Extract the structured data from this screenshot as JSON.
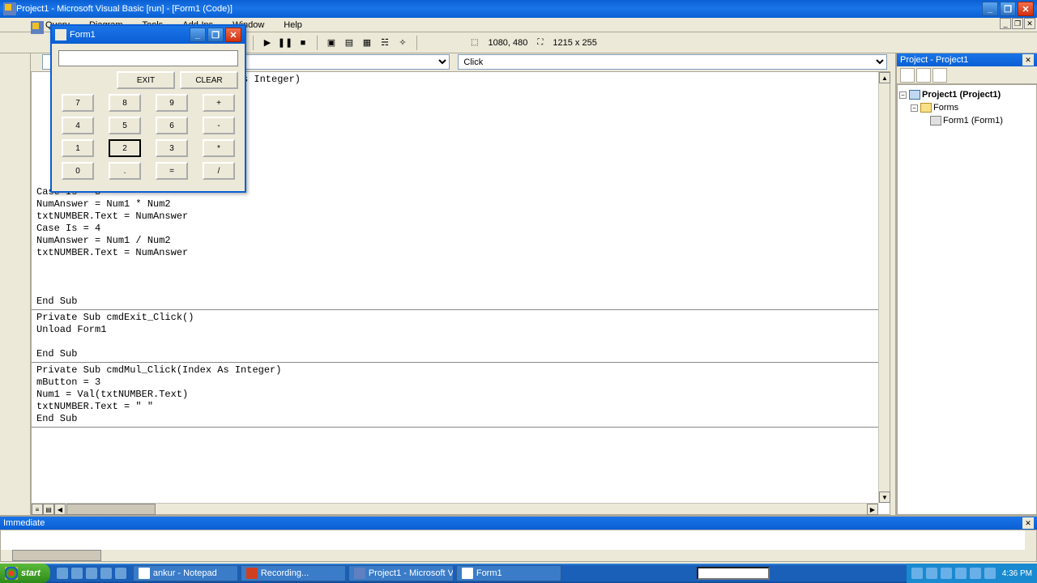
{
  "app": {
    "title": "Project1 - Microsoft Visual Basic [run] - [Form1 (Code)]"
  },
  "menu": {
    "query": "Query",
    "diagram": "Diagram",
    "tools": "Tools",
    "addins": "Add-Ins",
    "window": "Window",
    "help": "Help"
  },
  "toolbar": {
    "coords": "1080, 480",
    "size": "1215 x 255"
  },
  "dropdowns": {
    "object_visible": "",
    "proc": "Click"
  },
  "code": {
    "top_fragment": "s Integer)",
    "block1": "Case Is = 3\nNumAnswer = Num1 * Num2\ntxtNUMBER.Text = NumAnswer\nCase Is = 4\nNumAnswer = Num1 / Num2\ntxtNUMBER.Text = NumAnswer\n\n\n\nEnd Sub",
    "block2": "Private Sub cmdExit_Click()\nUnload Form1\n\nEnd Sub",
    "block3": "Private Sub cmdMul_Click(Index As Integer)\nmButton = 3\nNum1 = Val(txtNUMBER.Text)\ntxtNUMBER.Text = \" \"\nEnd Sub"
  },
  "project": {
    "panel_title": "Project - Project1",
    "root": "Project1 (Project1)",
    "folder": "Forms",
    "form": "Form1 (Form1)"
  },
  "immediate": {
    "title": "Immediate"
  },
  "form1": {
    "title": "Form1",
    "exit": "EXIT",
    "clear": "CLEAR",
    "keys": {
      "r1": [
        "7",
        "8",
        "9",
        "+"
      ],
      "r2": [
        "4",
        "5",
        "6",
        "-"
      ],
      "r3": [
        "1",
        "2",
        "3",
        "*"
      ],
      "r4": [
        "0",
        ".",
        "=",
        "/"
      ]
    }
  },
  "taskbar": {
    "start": "start",
    "tasks": [
      "ankur - Notepad",
      "Recording...",
      "Project1 - Microsoft V...",
      "Form1"
    ],
    "clock": "4:36 PM"
  }
}
